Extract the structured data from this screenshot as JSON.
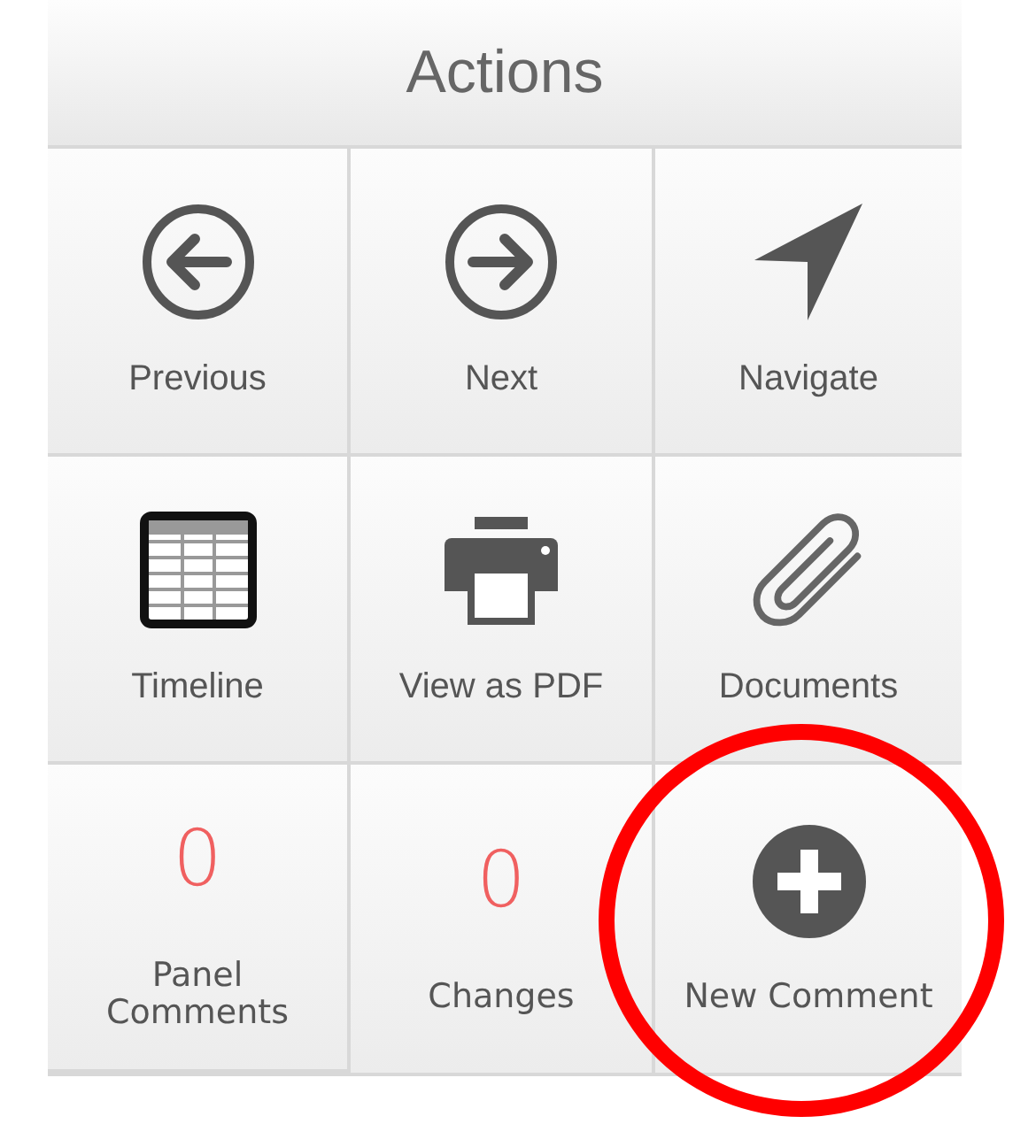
{
  "panel": {
    "title": "Actions"
  },
  "actions": [
    {
      "kind": "icon",
      "label": "Previous",
      "circled": false
    },
    {
      "kind": "icon",
      "label": "Next",
      "circled": false
    },
    {
      "kind": "icon",
      "label": "Navigate",
      "circled": false
    },
    {
      "kind": "icon",
      "label": "Timeline",
      "circled": false
    },
    {
      "kind": "icon",
      "label": "View as PDF",
      "circled": false
    },
    {
      "kind": "icon",
      "label": "Documents",
      "circled": false
    },
    {
      "kind": "count",
      "count": "0",
      "label": "Panel Comments",
      "circled": false
    },
    {
      "kind": "count",
      "count": "0",
      "label": "Changes",
      "circled": false
    },
    {
      "kind": "icon",
      "label": "New Comment",
      "circled": true
    }
  ]
}
